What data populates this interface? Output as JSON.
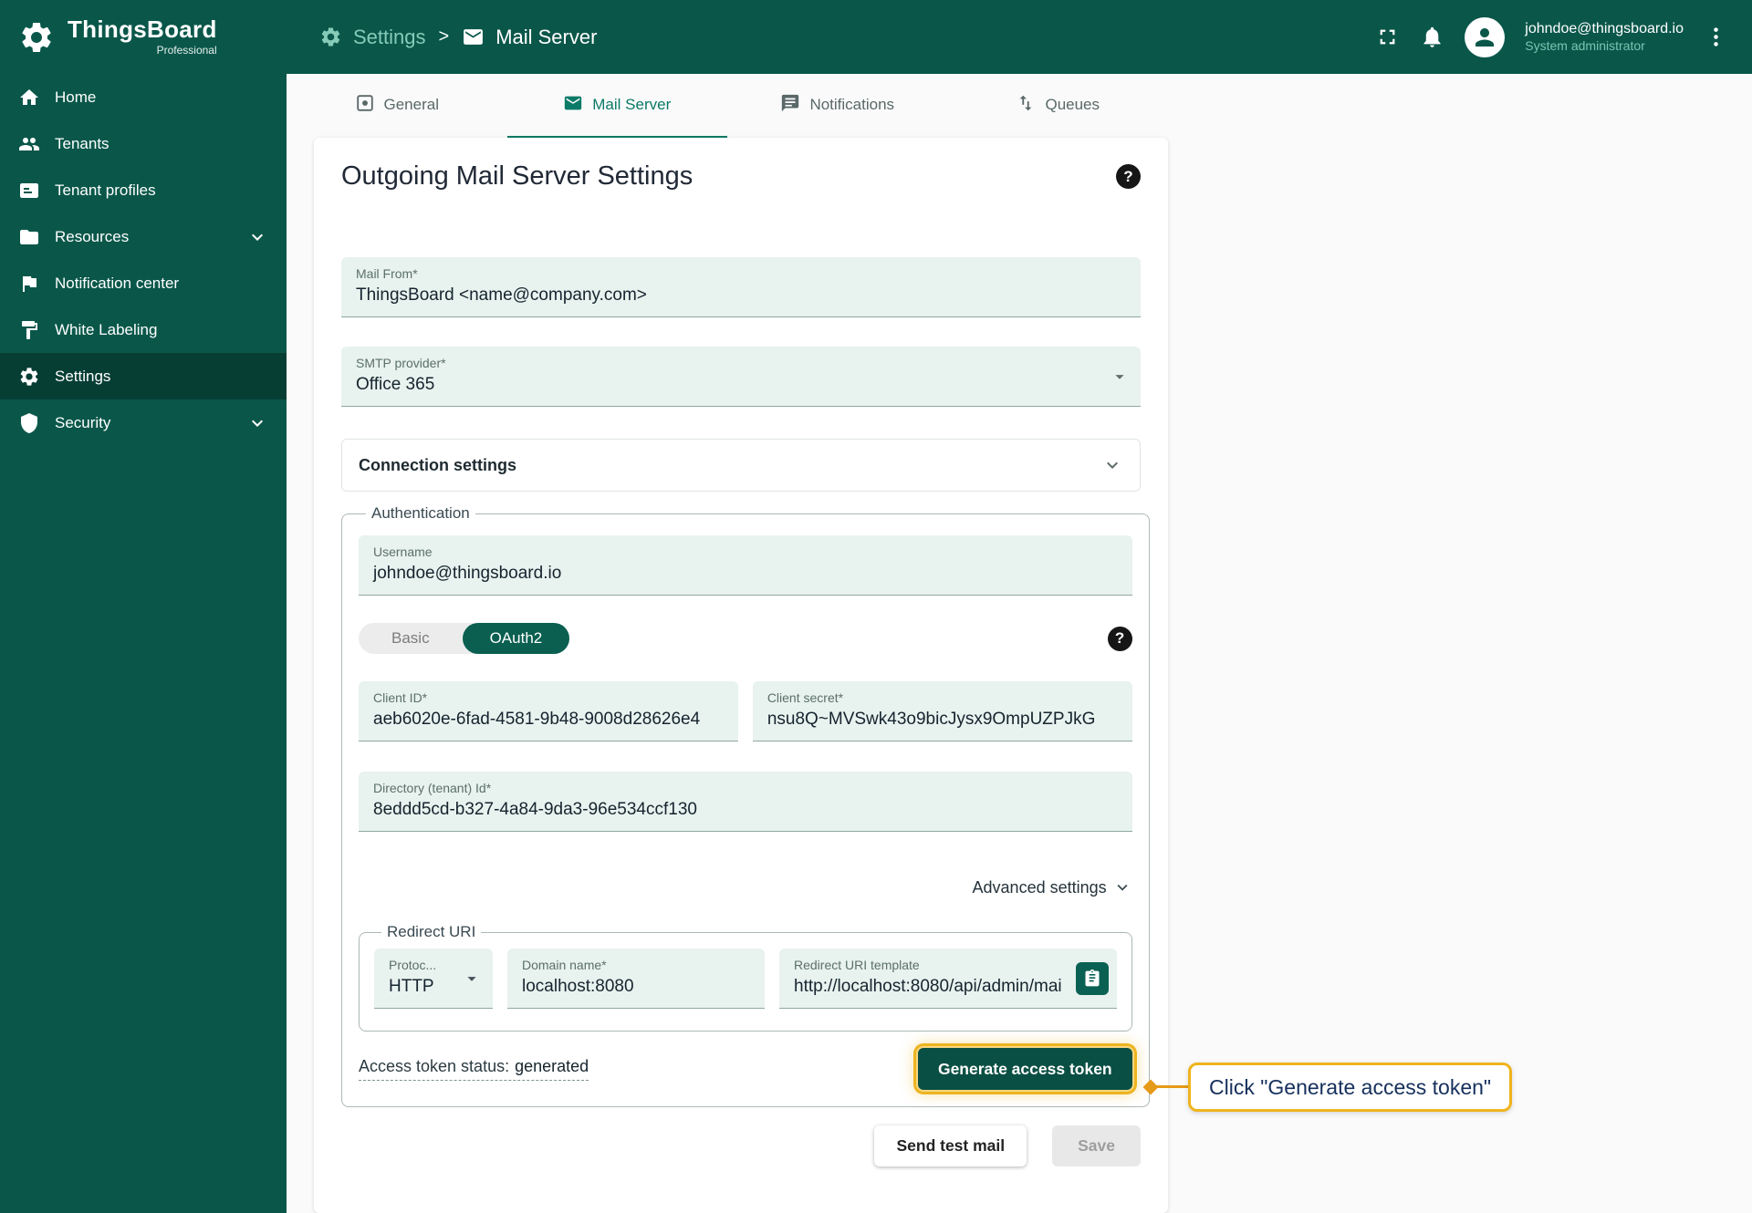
{
  "colors": {
    "primary": "#0a574a",
    "sidebar_active": "#063e34",
    "accent_tab": "#0b7a67",
    "field_bg": "#e8f2ef",
    "pill_active": "#0a5f50",
    "generate_button": "#0a4f43",
    "highlight_ring": "#edb421",
    "callout_border": "#efb41d",
    "callout_text": "#16305c",
    "breadcrumb_section": "#86cbb8"
  },
  "brand": {
    "name": "ThingsBoard",
    "subtitle": "Professional"
  },
  "header": {
    "breadcrumb": {
      "section": "Settings",
      "separator": ">",
      "page": "Mail Server"
    },
    "user": {
      "email": "johndoe@thingsboard.io",
      "role": "System administrator"
    }
  },
  "sidebar": {
    "items": [
      {
        "label": "Home",
        "icon": "home-icon"
      },
      {
        "label": "Tenants",
        "icon": "people-icon"
      },
      {
        "label": "Tenant profiles",
        "icon": "profile-card-icon"
      },
      {
        "label": "Resources",
        "icon": "folder-icon",
        "expandable": true
      },
      {
        "label": "Notification center",
        "icon": "flag-icon"
      },
      {
        "label": "White Labeling",
        "icon": "paint-icon"
      },
      {
        "label": "Settings",
        "icon": "gear-icon",
        "active": true
      },
      {
        "label": "Security",
        "icon": "shield-icon",
        "expandable": true
      }
    ]
  },
  "tabs": [
    {
      "label": "General"
    },
    {
      "label": "Mail Server",
      "active": true
    },
    {
      "label": "Notifications"
    },
    {
      "label": "Queues"
    }
  ],
  "form": {
    "title": "Outgoing Mail Server Settings",
    "help_glyph": "?",
    "mail_from": {
      "label": "Mail From*",
      "value": "ThingsBoard <name@company.com>"
    },
    "smtp_provider": {
      "label": "SMTP provider*",
      "value": "Office 365"
    },
    "connection_settings_label": "Connection settings",
    "authentication": {
      "legend": "Authentication",
      "username": {
        "label": "Username",
        "value": "johndoe@thingsboard.io"
      },
      "toggle": {
        "basic": "Basic",
        "oauth2": "OAuth2"
      },
      "client_id": {
        "label": "Client ID*",
        "value": "aeb6020e-6fad-4581-9b48-9008d28626e4"
      },
      "client_secret": {
        "label": "Client secret*",
        "value": "nsu8Q~MVSwk43o9bicJysx9OmpUZPJkG"
      },
      "tenant_id": {
        "label": "Directory (tenant) Id*",
        "value": "8eddd5cd-b327-4a84-9da3-96e534ccf130"
      },
      "advanced_settings_label": "Advanced settings",
      "redirect_uri": {
        "legend": "Redirect URI",
        "protocol": {
          "label": "Protoc...",
          "value": "HTTP"
        },
        "domain": {
          "label": "Domain name*",
          "value": "localhost:8080"
        },
        "template": {
          "label": "Redirect URI template",
          "value": "http://localhost:8080/api/admin/mai"
        }
      },
      "access_token": {
        "status_label": "Access token status:",
        "status_value": "generated",
        "generate_label": "Generate access token"
      }
    },
    "actions": {
      "send_test_label": "Send test mail",
      "save_label": "Save"
    }
  },
  "callout": {
    "text": "Click \"Generate access token\""
  }
}
